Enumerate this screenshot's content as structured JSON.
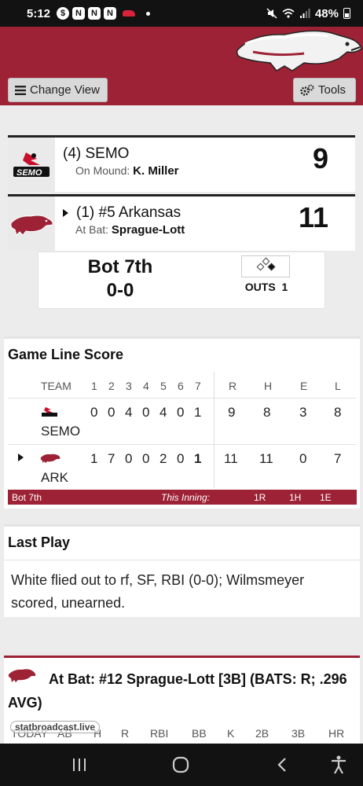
{
  "status_bar": {
    "time": "5:12",
    "battery": "48%",
    "notif_icons": [
      "dollar-icon",
      "n-icon",
      "n-icon",
      "n-icon",
      "razorback-icon"
    ]
  },
  "header": {
    "change_view_label": "Change View",
    "tools_label": "Tools"
  },
  "teams": [
    {
      "name": "(4) SEMO",
      "sub_label": "On Mound:",
      "sub_value": "K. Miller",
      "score": "9",
      "logo_text": "SEMO",
      "batting": false
    },
    {
      "name": "(1) #5 Arkansas",
      "sub_label": "At Bat:",
      "sub_value": "Sprague-Lott",
      "score": "11",
      "batting": true
    }
  ],
  "game_state": {
    "inning": "Bot 7th",
    "count": "0-0",
    "outs_label": "OUTS",
    "outs": "1",
    "bases": {
      "first": true,
      "second": false,
      "third": false
    }
  },
  "line_score": {
    "title": "Game Line Score",
    "team_header": "TEAM",
    "innings": [
      "1",
      "2",
      "3",
      "4",
      "5",
      "6",
      "7"
    ],
    "totals_headers": [
      "R",
      "H",
      "E",
      "L"
    ],
    "rows": [
      {
        "team": "SEMO",
        "innings": [
          "0",
          "0",
          "4",
          "0",
          "4",
          "0",
          "1"
        ],
        "totals": [
          "9",
          "8",
          "3",
          "8"
        ]
      },
      {
        "team": "ARK",
        "innings": [
          "1",
          "7",
          "0",
          "0",
          "2",
          "0",
          "1"
        ],
        "totals": [
          "11",
          "11",
          "0",
          "7"
        ]
      }
    ],
    "footer": {
      "inning": "Bot 7th",
      "label": "This Inning:",
      "runs": "1R",
      "hits": "1H",
      "errors": "1E"
    }
  },
  "last_play": {
    "title": "Last Play",
    "text": "White flied out to rf, SF, RBI (0-0); Wilmsmeyer scored, unearned."
  },
  "at_bat": {
    "text": "At Bat: #12 Sprague-Lott [3B] (BATS: R; .296 AVG)",
    "stat_headers": [
      "TODAY",
      "AB",
      "H",
      "R",
      "RBI",
      "BB",
      "K",
      "2B",
      "3B",
      "HR"
    ],
    "watermark": "statbroadcast.live"
  },
  "colors": {
    "brand": "#9d2235",
    "background": "#ececec"
  }
}
